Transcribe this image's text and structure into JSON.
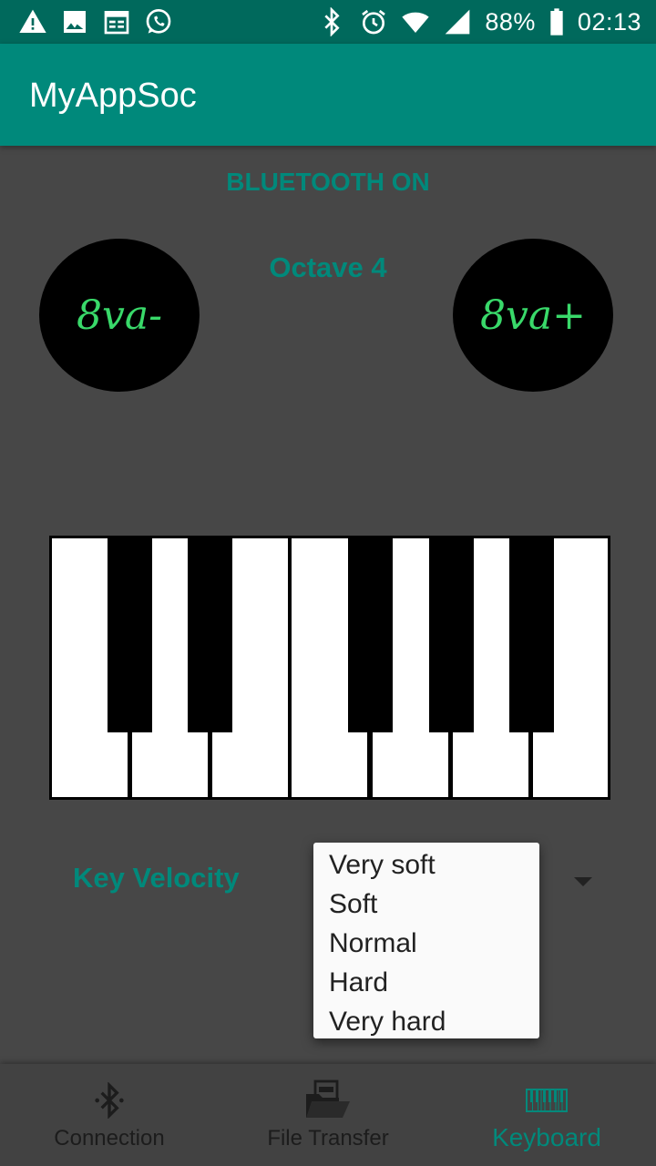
{
  "status_bar": {
    "left_icons": [
      "warning-icon",
      "image-icon",
      "calendar-icon",
      "whatsapp-icon"
    ],
    "right_icons": [
      "bluetooth-icon",
      "alarm-icon",
      "wifi-icon",
      "signal-icon",
      "battery-icon"
    ],
    "battery": "88%",
    "time": "02:13"
  },
  "app_bar": {
    "title": "MyAppSoc"
  },
  "main": {
    "bluetooth_status": "BLUETOOTH ON",
    "octave_label": "Octave 4",
    "octave_down_label": "8va-",
    "octave_up_label": "8va+",
    "velocity_label": "Key Velocity"
  },
  "velocity_dropdown": {
    "options": [
      "Very soft",
      "Soft",
      "Normal",
      "Hard",
      "Very hard"
    ]
  },
  "bottom_nav": {
    "items": [
      {
        "label": "Connection",
        "icon": "bluetooth-icon",
        "active": false
      },
      {
        "label": "File Transfer",
        "icon": "midi-folder-icon",
        "active": false
      },
      {
        "label": "Keyboard",
        "icon": "piano-icon",
        "active": true
      }
    ]
  },
  "colors": {
    "primary": "#00897b",
    "primary_dark": "#00695c",
    "background": "#474747",
    "octave_text": "#39d96a"
  }
}
